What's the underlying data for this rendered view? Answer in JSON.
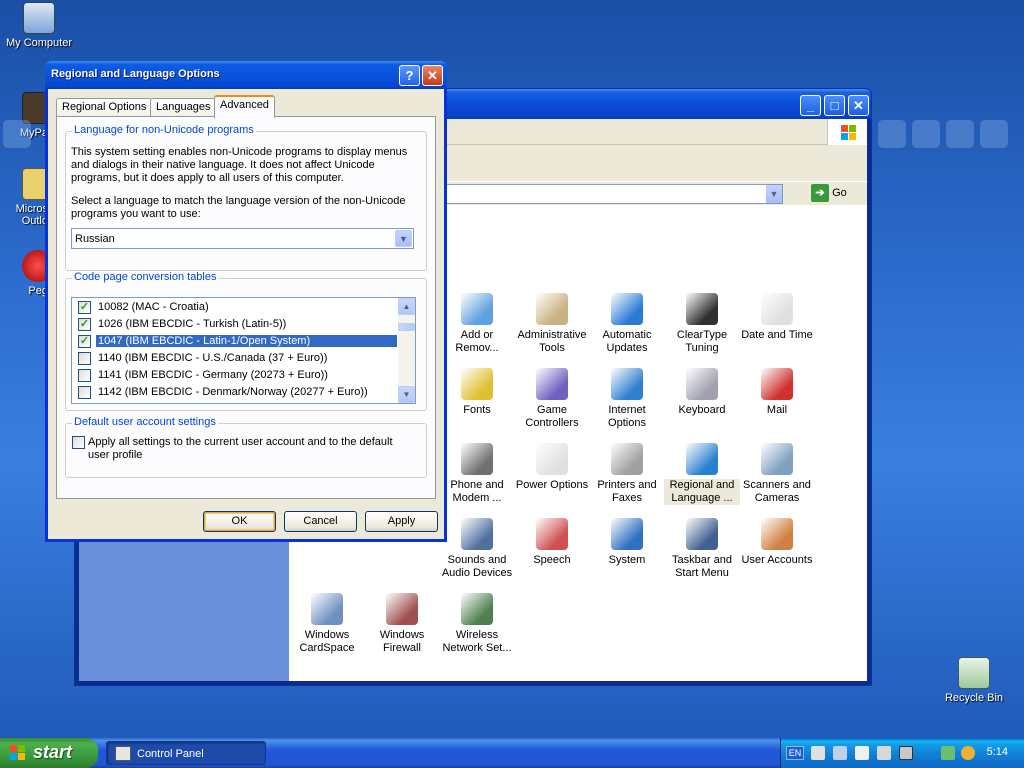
{
  "desktop": {
    "icons": [
      {
        "label": "My Computer"
      },
      {
        "label": "MyPa"
      },
      {
        "label": "Micros Outlo"
      },
      {
        "label": "Peg"
      },
      {
        "label": "Recycle Bin"
      }
    ]
  },
  "control_panel": {
    "address_go": "Go",
    "applets": [
      {
        "label": "Add or Remov..."
      },
      {
        "label": "Administrative Tools"
      },
      {
        "label": "Automatic Updates"
      },
      {
        "label": "ClearType Tuning"
      },
      {
        "label": "Date and Time"
      },
      {
        "label": "Fonts"
      },
      {
        "label": "Game Controllers"
      },
      {
        "label": "Internet Options"
      },
      {
        "label": "Keyboard"
      },
      {
        "label": "Mail"
      },
      {
        "label": "Phone and Modem ..."
      },
      {
        "label": "Power Options"
      },
      {
        "label": "Printers and Faxes"
      },
      {
        "label": "Regional and Language ..."
      },
      {
        "label": "Scanners and Cameras"
      },
      {
        "label": "Sounds and Audio Devices"
      },
      {
        "label": "Speech"
      },
      {
        "label": "System"
      },
      {
        "label": "Taskbar and Start Menu"
      },
      {
        "label": "User Accounts"
      },
      {
        "label": "Windows CardSpace"
      },
      {
        "label": "Windows Firewall"
      },
      {
        "label": "Wireless Network Set..."
      }
    ]
  },
  "dialog": {
    "title": "Regional and Language Options",
    "help_glyph": "?",
    "close_glyph": "✕",
    "tabs": [
      {
        "label": "Regional Options"
      },
      {
        "label": "Languages"
      },
      {
        "label": "Advanced"
      }
    ],
    "active_tab": "Advanced",
    "non_unicode": {
      "legend": "Language for non-Unicode programs",
      "description": "This system setting enables non-Unicode programs to display menus and dialogs in their native language. It does not affect Unicode programs, but it does apply to all users of this computer.",
      "prompt": "Select a language to match the language version of the non-Unicode programs you want to use:",
      "selected_language": "Russian"
    },
    "code_pages": {
      "legend": "Code page conversion tables",
      "items": [
        {
          "label": "10082  (MAC - Croatia)",
          "checked": true
        },
        {
          "label": "1026  (IBM EBCDIC - Turkish (Latin-5))",
          "checked": true
        },
        {
          "label": "1047  (IBM EBCDIC - Latin-1/Open System)",
          "checked": true,
          "selected": true
        },
        {
          "label": "1140  (IBM EBCDIC - U.S./Canada (37 + Euro))",
          "checked": false
        },
        {
          "label": "1141  (IBM EBCDIC - Germany (20273 + Euro))",
          "checked": false
        },
        {
          "label": "1142  (IBM EBCDIC - Denmark/Norway (20277 + Euro))",
          "checked": false
        }
      ]
    },
    "default_user": {
      "legend": "Default user account settings",
      "checkbox_label": "Apply all settings to the current user account and to the default user profile",
      "checked": false
    },
    "buttons": {
      "ok": "OK",
      "cancel": "Cancel",
      "apply": "Apply"
    }
  },
  "taskbar": {
    "start_label": "start",
    "task_label": "Control Panel",
    "language": "EN",
    "clock": "5:14"
  },
  "colors": {
    "titlebar_blue": "#0a52dc",
    "selection_blue": "#316ac5",
    "start_green": "#35973a",
    "dialog_face": "#ece9d8",
    "group_legend": "#0046d5"
  }
}
